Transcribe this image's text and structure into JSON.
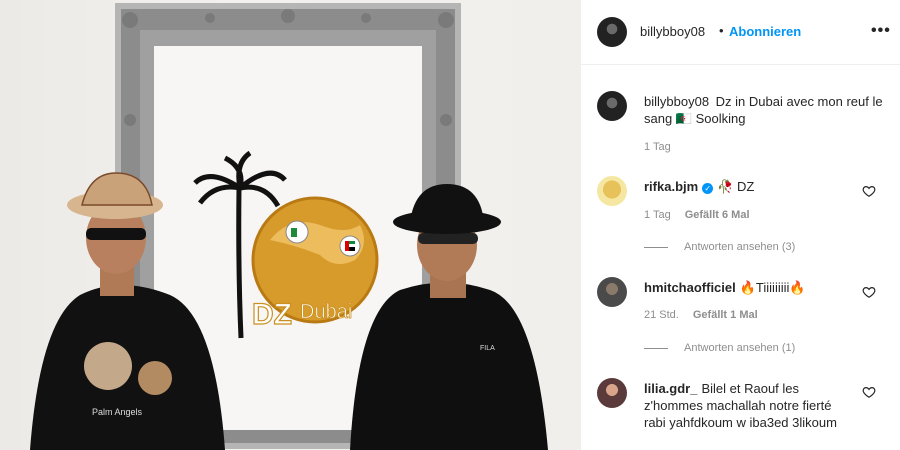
{
  "header": {
    "username": "billybboy08",
    "separator": "•",
    "follow_label": "Abonnieren",
    "more_icon": "•••"
  },
  "caption": {
    "username": "billybboy08",
    "text": "Dz in Dubai avec mon reuf le sang 🇩🇿 Soolking",
    "time": "1 Tag"
  },
  "photo": {
    "logo_text_dz": "DZ",
    "logo_text_city": "Dubai",
    "tshirt_brand": "Palm Angels",
    "tshirt_brand2": "FILA"
  },
  "comments": [
    {
      "username": "rifka.bjm",
      "verified": true,
      "text": "🥀 DZ",
      "time": "1 Tag",
      "likes": "Gefällt 6 Mal",
      "replies": "Antworten ansehen (3)"
    },
    {
      "username": "hmitchaofficiel",
      "verified": false,
      "text": "🔥Tiiiiiiiii🔥",
      "time": "21 Std.",
      "likes": "Gefällt 1 Mal",
      "replies": "Antworten ansehen (1)"
    },
    {
      "username": "lilia.gdr_",
      "verified": false,
      "text": "Bilel et Raouf les z'hommes machallah notre fierté rabi yahfdkoum w iba3ed 3likoum"
    }
  ],
  "icons": {
    "heart": "heart-icon",
    "more": "more-options-icon",
    "verified": "verified-badge-icon"
  },
  "colors": {
    "accent": "#0095f6",
    "muted": "#8e8e8e",
    "text": "#262626"
  }
}
